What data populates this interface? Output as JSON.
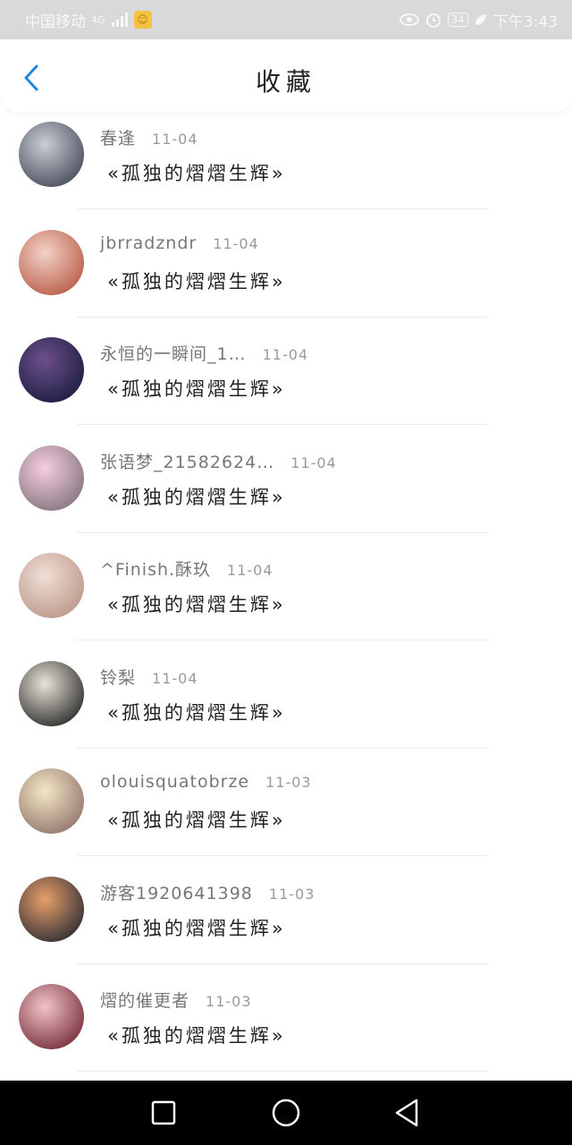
{
  "statusbar": {
    "carrier": "中国移动",
    "network": "4G",
    "battery": "34",
    "time": "下午3:43"
  },
  "header": {
    "title": "收藏",
    "back_icon": "chevron-left-icon",
    "accent_color": "#1e88e5"
  },
  "items": [
    {
      "name": "春逢",
      "date": "11-04",
      "content": "«孤独的熠熠生辉»",
      "avatar_colors": [
        "#c9cdd6",
        "#3d4250"
      ]
    },
    {
      "name": "jbrradzndr",
      "date": "11-04",
      "content": "«孤独的熠熠生辉»",
      "avatar_colors": [
        "#f3d2c8",
        "#b4533c"
      ]
    },
    {
      "name": "永恒的一瞬间_1…",
      "date": "11-04",
      "content": "«孤独的熠熠生辉»",
      "avatar_colors": [
        "#6d4f8c",
        "#141a3a"
      ]
    },
    {
      "name": "张语梦_21582624…",
      "date": "11-04",
      "content": "«孤独的熠熠生辉»",
      "avatar_colors": [
        "#f6cde0",
        "#7a6d74"
      ]
    },
    {
      "name": "^Finish.酥玖",
      "date": "11-04",
      "content": "«孤独的熠熠生辉»",
      "avatar_colors": [
        "#f0dfd6",
        "#b79183"
      ]
    },
    {
      "name": "铃梨",
      "date": "11-04",
      "content": "«孤独的熠熠生辉»",
      "avatar_colors": [
        "#e9e4d8",
        "#1c1c1c"
      ]
    },
    {
      "name": "olouisquatobrze",
      "date": "11-03",
      "content": "«孤独的熠熠生辉»",
      "avatar_colors": [
        "#f4e6c4",
        "#8a6d66"
      ]
    },
    {
      "name": "游客1920641398",
      "date": "11-03",
      "content": "«孤独的熠熠生辉»",
      "avatar_colors": [
        "#e8a06a",
        "#1d2230"
      ]
    },
    {
      "name": "熠的催更者",
      "date": "11-03",
      "content": "«孤独的熠熠生辉»",
      "avatar_colors": [
        "#f2c3c8",
        "#6b2230"
      ]
    }
  ],
  "navbar": {
    "recent_icon": "square-icon",
    "home_icon": "circle-icon",
    "back_icon": "triangle-back-icon"
  }
}
